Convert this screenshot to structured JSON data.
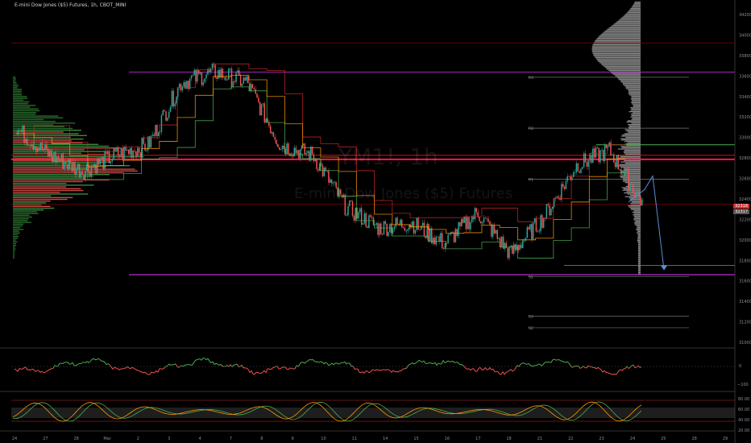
{
  "title": "E-mini Dow Jones ($5) Futures, 1h, CBOT_MINI",
  "watermark": {
    "symbol": "YM1!, 1h",
    "name": "E-mini Dow Jones ($5) Futures"
  },
  "colors": {
    "up": "#26a69a",
    "down": "#ef5350",
    "purple": "#9c27b0",
    "red_line": "#ff1744",
    "green_line": "#4caf50",
    "orange": "#ff9800",
    "blue_arrow": "#5b8fd6",
    "volume_gray": "#b0b0b0"
  },
  "price_axis": [
    "34200",
    "34000",
    "33800",
    "33600",
    "33400",
    "33200",
    "33000",
    "32800",
    "32600",
    "32400",
    "32200",
    "32000",
    "31800",
    "31600",
    "31400",
    "31200",
    "31000"
  ],
  "current_price": {
    "label": "32318",
    "sub": "32317"
  },
  "pivot_labels": [
    "R3",
    "R2",
    "R1",
    "S1",
    "S2",
    "S3"
  ],
  "osc1_axis": [
    "0",
    "−100"
  ],
  "osc2_axis": [
    "80.00",
    "60.00",
    "40.00",
    "20.00"
  ],
  "time_axis": [
    "24",
    "27",
    "28",
    "Mar",
    "2",
    "3",
    "4",
    "7",
    "8",
    "9",
    "10",
    "11",
    "14",
    "15",
    "16",
    "17",
    "18",
    "21",
    "22",
    "23",
    "24",
    "25",
    "28",
    "29"
  ],
  "chart_data": {
    "type": "line",
    "title": "E-mini Dow Jones ($5) Futures, 1h, CBOT_MINI",
    "ylim": [
      31000,
      34200
    ],
    "x": [
      "24",
      "27",
      "28",
      "Mar",
      "2",
      "3",
      "4",
      "7",
      "8",
      "9",
      "10",
      "11",
      "14",
      "15",
      "16",
      "17",
      "18",
      "21",
      "22",
      "23"
    ],
    "series": [
      {
        "name": "",
        "values": [
          33050,
          32800,
          32650,
          32800,
          32900,
          33500,
          33600,
          33500,
          32900,
          32800,
          32300,
          32100,
          32150,
          31950,
          32250,
          31850,
          32200,
          32700,
          32850,
          32350
        ]
      }
    ],
    "levels": [
      {
        "value": 33600,
        "label": ""
      },
      {
        "value": 32760,
        "label": ""
      },
      {
        "value": 31650,
        "label": ""
      }
    ],
    "projection": [
      32350,
      32600,
      31700
    ]
  }
}
